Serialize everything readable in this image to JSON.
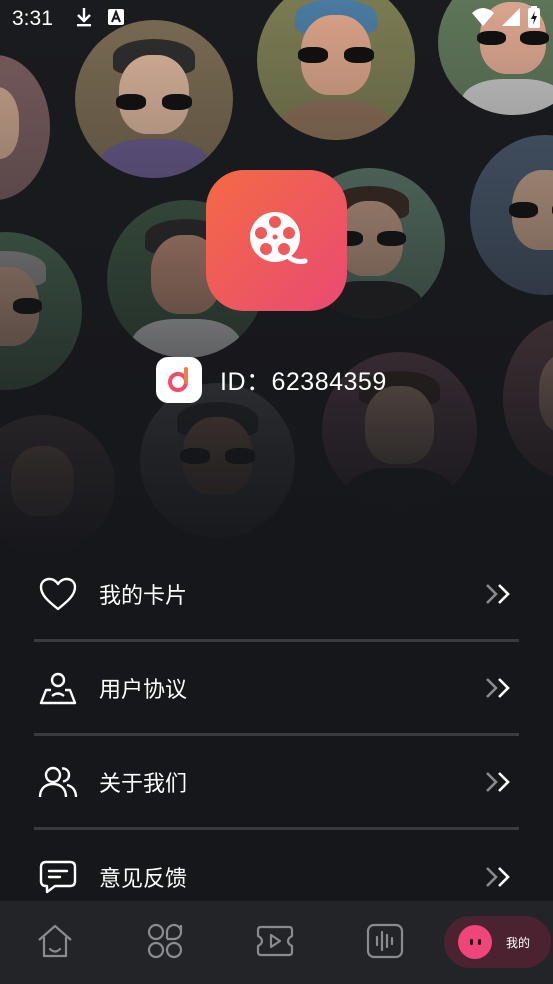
{
  "status_bar": {
    "time": "3:31",
    "icons_left": [
      "download-icon",
      "text-a-icon"
    ],
    "icons_right": [
      "wifi-icon",
      "cell-signal-icon",
      "battery-charging-icon"
    ]
  },
  "profile": {
    "logo_icon": "film-reel-icon",
    "badge_icon": "app-badge-icon",
    "id_text": "ID：62384359"
  },
  "menu": {
    "items": [
      {
        "label": "我的卡片",
        "icon": "heart-icon"
      },
      {
        "label": "用户协议",
        "icon": "user-location-icon"
      },
      {
        "label": "关于我们",
        "icon": "users-icon"
      },
      {
        "label": "意见反馈",
        "icon": "message-icon"
      }
    ],
    "arrow_icon": "double-chevron-right-icon"
  },
  "bottom_nav": {
    "tabs": [
      {
        "icon": "home-icon"
      },
      {
        "icon": "grid-clover-icon"
      },
      {
        "icon": "video-play-icon"
      },
      {
        "icon": "audio-wave-icon"
      }
    ],
    "active": {
      "label": "我的",
      "icon": "face-icon"
    }
  },
  "colors": {
    "background": "#16171b",
    "accent_gradient_start": "#f36a45",
    "accent_gradient_end": "#ea4a73",
    "active_tab_bg": "#4a2230",
    "active_tab_icon": "#f0457a",
    "divider": "#3a3b40",
    "nav_bg": "#232428"
  }
}
